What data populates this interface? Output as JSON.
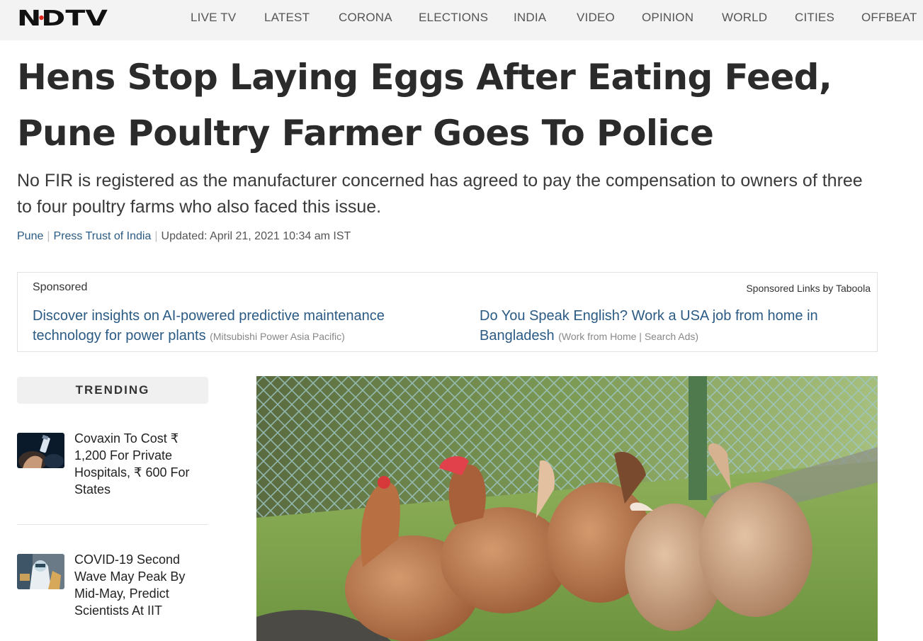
{
  "brand": {
    "logo_text": "NDTV",
    "accent": "#e0251b",
    "logo_color": "#111111",
    "link_color": "#2b5b84"
  },
  "nav": [
    {
      "label": "LIVE TV"
    },
    {
      "label": "LATEST"
    },
    {
      "label": "CORONA"
    },
    {
      "label": "ELECTIONS"
    },
    {
      "label": "INDIA"
    },
    {
      "label": "VIDEO"
    },
    {
      "label": "OPINION"
    },
    {
      "label": "WORLD"
    },
    {
      "label": "CITIES"
    },
    {
      "label": "OFFBEAT"
    }
  ],
  "article": {
    "headline": "Hens Stop Laying Eggs After Eating Feed, Pune Poultry Farmer Goes To Police",
    "subheadline": "No FIR is registered as the manufacturer concerned has agreed to pay the compensation to owners of three to four poultry farms who also faced this issue.",
    "byline": {
      "location": "Pune",
      "source": "Press Trust of India",
      "updated": "Updated: April 21, 2021 10:34 am IST"
    }
  },
  "sponsored": {
    "label": "Sponsored",
    "by": "Sponsored Links by Taboola",
    "links": [
      {
        "title": "Discover insights on AI-powered predictive maintenance technology for power plants",
        "source": "(Mitsubishi Power Asia Pacific)"
      },
      {
        "title": "Do You Speak English? Work a USA job from home in Bangladesh",
        "source": "(Work from Home | Search Ads)"
      }
    ]
  },
  "trending": {
    "heading": "TRENDING",
    "items": [
      {
        "title": "Covaxin To Cost ₹ 1,200 For Private Hospitals, ₹ 600 For States",
        "thumb": "vaccine-vial-photo"
      },
      {
        "title": "COVID-19 Second Wave May Peak By Mid-May, Predict Scientists At IIT",
        "thumb": "ppe-health-worker-photo"
      }
    ]
  },
  "hero_image": {
    "depicts": "hens-near-chain-link-fence-photo"
  }
}
